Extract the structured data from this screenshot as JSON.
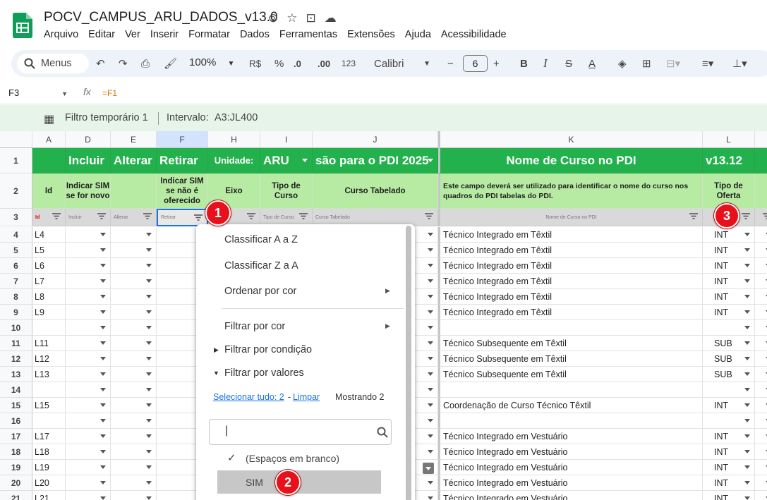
{
  "doc": {
    "title": "POCV_CAMPUS_ARU_DADOS_v13.0"
  },
  "menu": [
    "Arquivo",
    "Editar",
    "Ver",
    "Inserir",
    "Formatar",
    "Dados",
    "Ferramentas",
    "Extensões",
    "Ajuda",
    "Acessibilidade"
  ],
  "toolbar": {
    "search": "Menus",
    "zoom": "100%",
    "currency": "R$",
    "percent": "%",
    "dec_less": ".0",
    "dec_more": ".00",
    "number_fmt": "123",
    "font": "Calibri",
    "font_size": "6"
  },
  "formula_bar": {
    "cell_ref": "F3",
    "fx": "fx",
    "formula": "=F1"
  },
  "filter_bar": {
    "label": "Filtro temporário 1",
    "range_label": "Intervalo:",
    "range": "A3:JL400"
  },
  "columns": [
    "A",
    "D",
    "E",
    "F",
    "H",
    "I",
    "J",
    "K",
    "L"
  ],
  "header_row1": {
    "incluir": "Incluir",
    "alterar": "Alterar",
    "retirar": "Retirar",
    "unidade_label": "Unidade:",
    "unidade": "ARU",
    "pdi": "são para o PDI 2025",
    "nome_curso": "Nome de Curso no PDI",
    "version": "v13.12"
  },
  "header_row2": {
    "id": "Id",
    "incluir": "Indicar SIM se for novo",
    "retirar": "Indicar SIM se não é oferecido",
    "eixo": "Eixo",
    "tipo_curso": "Tipo de Curso",
    "curso_tab": "Curso Tabelado",
    "nome_desc": "Este campo deverá ser utilizado para identificar o nome do curso nos quadros do PDI tabelas do PDI.",
    "tipo_oferta": "Tipo de Oferta"
  },
  "header_row3": {
    "id": "Id",
    "incluir": "Incluir",
    "alterar": "Alterar",
    "retirar": "Retirar",
    "tipo_curso": "Tipo de Curso",
    "curso_tab": "Curso Tabelado",
    "nome": "Nome de Curso no PDI"
  },
  "rows": [
    {
      "n": "4",
      "id": "L4",
      "nome": "Técnico Integrado em Têxtil",
      "tipo": "INT"
    },
    {
      "n": "5",
      "id": "L5",
      "nome": "Técnico Integrado em Têxtil",
      "tipo": "INT"
    },
    {
      "n": "6",
      "id": "L6",
      "nome": "Técnico Integrado em Têxtil",
      "tipo": "INT"
    },
    {
      "n": "7",
      "id": "L7",
      "nome": "Técnico Integrado em Têxtil",
      "tipo": "INT"
    },
    {
      "n": "8",
      "id": "L8",
      "nome": "Técnico Integrado em Têxtil",
      "tipo": "INT"
    },
    {
      "n": "9",
      "id": "L9",
      "nome": "Técnico Integrado em Têxtil",
      "tipo": "INT"
    },
    {
      "n": "10",
      "id": "",
      "nome": "",
      "tipo": ""
    },
    {
      "n": "11",
      "id": "L11",
      "nome": "Técnico Subsequente em Têxtil",
      "tipo": "SUB"
    },
    {
      "n": "12",
      "id": "L12",
      "nome": "Técnico Subsequente em Têxtil",
      "tipo": "SUB"
    },
    {
      "n": "13",
      "id": "L13",
      "nome": "Técnico Subsequente em Têxtil",
      "tipo": "SUB"
    },
    {
      "n": "14",
      "id": "",
      "nome": "",
      "tipo": ""
    },
    {
      "n": "15",
      "id": "L15",
      "nome": "Coordenação de Curso Técnico Têxtil",
      "tipo": "INT"
    },
    {
      "n": "16",
      "id": "",
      "nome": "",
      "tipo": ""
    },
    {
      "n": "17",
      "id": "L17",
      "nome": "Técnico Integrado em Vestuário",
      "tipo": "INT"
    },
    {
      "n": "18",
      "id": "L18",
      "nome": "Técnico Integrado em Vestuário",
      "tipo": "INT"
    },
    {
      "n": "19",
      "id": "L19",
      "nome": "Técnico Integrado em Vestuário",
      "tipo": "INT"
    },
    {
      "n": "20",
      "id": "L20",
      "nome": "Técnico Integrado em Vestuário",
      "tipo": "INT"
    },
    {
      "n": "21",
      "id": "L21",
      "nome": "Técnico Integrado em Vestuário",
      "tipo": "INT"
    }
  ],
  "popup": {
    "sort_az": "Classificar A a Z",
    "sort_za": "Classificar Z a A",
    "sort_color": "Ordenar por cor",
    "filter_color": "Filtrar por cor",
    "filter_cond": "Filtrar por condição",
    "filter_values": "Filtrar por valores",
    "select_all": "Selecionar tudo: 2",
    "clear": "Limpar",
    "showing": "Mostrando 2",
    "search_value": "|",
    "opt_blank": "(Espaços em branco)",
    "opt_sim": "SIM"
  },
  "badges": [
    "1",
    "2",
    "3"
  ],
  "colors": {
    "header_green": "#22b14c",
    "subheader_green": "#b7eba4",
    "badge_red": "#e8101a"
  }
}
